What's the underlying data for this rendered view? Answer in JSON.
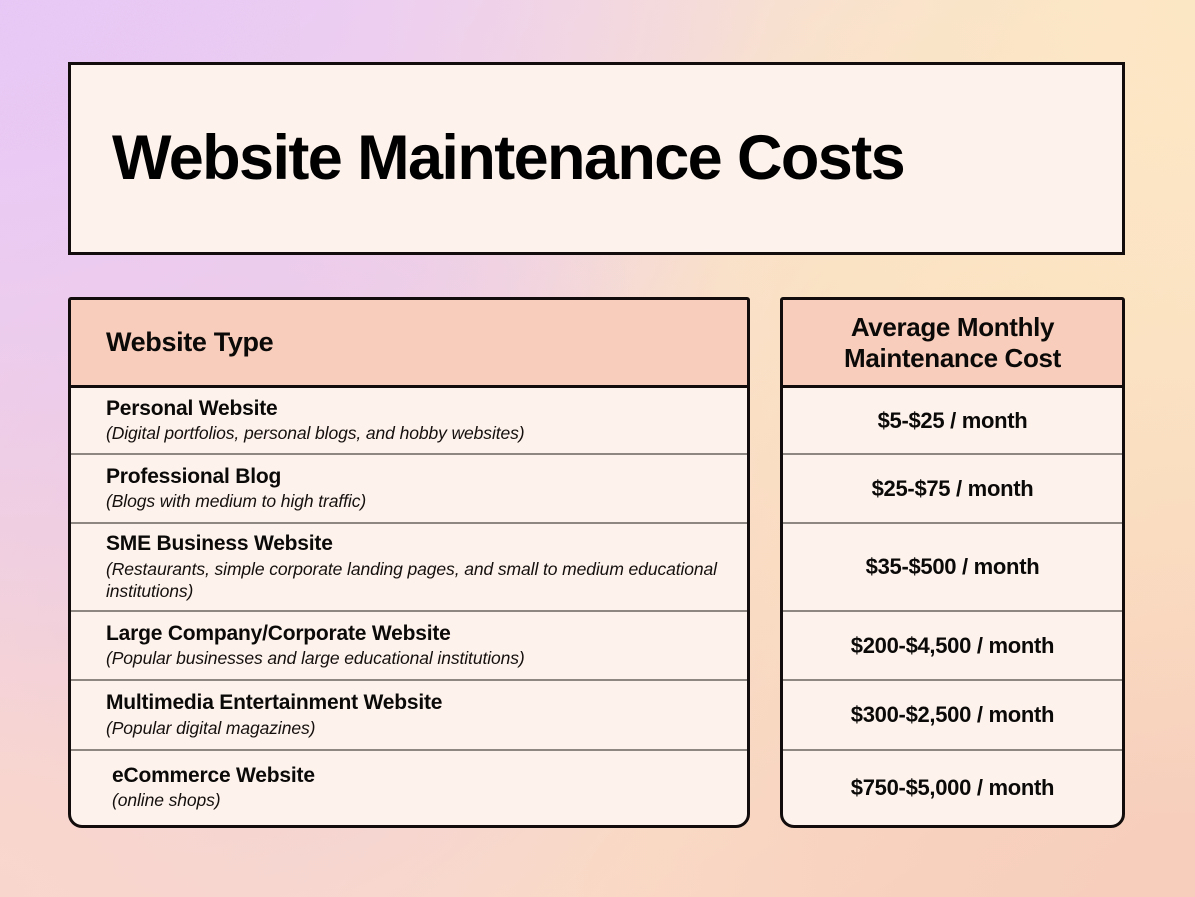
{
  "title": "Website Maintenance Costs",
  "colors": {
    "card_bg": "#FDF2EC",
    "header_peach": "#F9CDBB",
    "border_black": "#120D0C",
    "divider_gray": "#8D8681",
    "bg_lavender": "#E9C8F7",
    "bg_cream": "#FCE7C4",
    "bg_pink": "#F9D6CD",
    "bg_peach": "#F7CEBC"
  },
  "table": {
    "headers": {
      "type": "Website Type",
      "cost_line1": "Average Monthly",
      "cost_line2": "Maintenance Cost"
    },
    "rows": [
      {
        "name": "Personal Website",
        "desc": "(Digital portfolios, personal blogs, and hobby websites)",
        "cost": "$5-$25 / month"
      },
      {
        "name": "Professional Blog",
        "desc": "(Blogs with medium to high traffic)",
        "cost": "$25-$75 / month"
      },
      {
        "name": "SME Business Website",
        "desc": "(Restaurants, simple corporate landing pages, and small to medium educational institutions)",
        "cost": "$35-$500 / month"
      },
      {
        "name": "Large Company/Corporate Website",
        "desc": "(Popular businesses and large educational institutions)",
        "cost": "$200-$4,500 / month"
      },
      {
        "name": "Multimedia Entertainment Website",
        "desc": "(Popular digital magazines)",
        "cost": "$300-$2,500 / month"
      },
      {
        "name": "eCommerce Website",
        "desc": "(online shops)",
        "cost": "$750-$5,000 / month"
      }
    ]
  }
}
